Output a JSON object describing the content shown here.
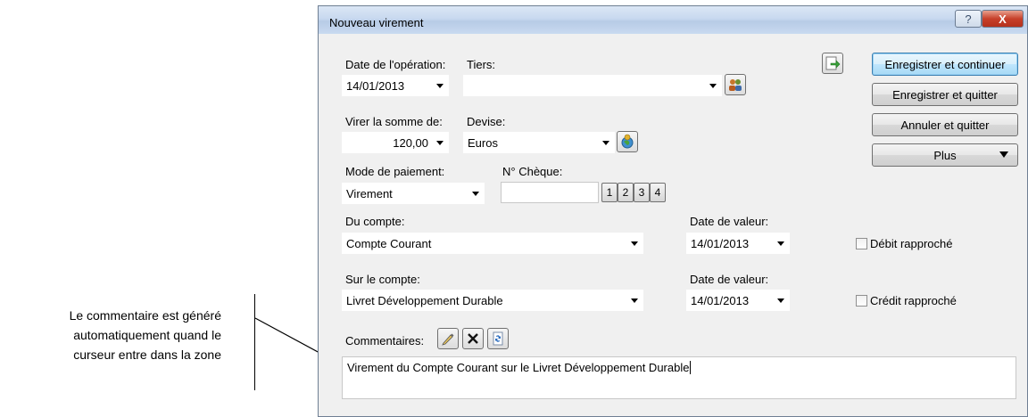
{
  "annotation": {
    "lines": [
      "Le commentaire est généré",
      "automatiquement quand le",
      "curseur entre dans la zone"
    ]
  },
  "window": {
    "title": "Nouveau virement",
    "help_label": "?",
    "close_label": "X"
  },
  "form": {
    "date_operation": {
      "label": "Date de l'opération:",
      "value": "14/01/2013"
    },
    "tiers": {
      "label": "Tiers:",
      "value": ""
    },
    "montant": {
      "label": "Virer la somme de:",
      "value": "120,00"
    },
    "devise": {
      "label": "Devise:",
      "value": "Euros"
    },
    "mode_paiement": {
      "label": "Mode de paiement:",
      "value": "Virement"
    },
    "cheque": {
      "label": "N° Chèque:",
      "value": "",
      "buttons": [
        "1",
        "2",
        "3",
        "4"
      ]
    },
    "du_compte": {
      "label": "Du compte:",
      "value": "Compte Courant"
    },
    "date_valeur_debit": {
      "label": "Date de valeur:",
      "value": "14/01/2013"
    },
    "debit_rapproche": {
      "label": "Débit rapproché",
      "checked": false
    },
    "sur_compte": {
      "label": "Sur le compte:",
      "value": "Livret Développement Durable"
    },
    "date_valeur_credit": {
      "label": "Date de valeur:",
      "value": "14/01/2013"
    },
    "credit_rapproche": {
      "label": "Crédit rapproché",
      "checked": false
    },
    "commentaires": {
      "label": "Commentaires:",
      "value": "Virement du Compte Courant sur le Livret Développement Durable"
    }
  },
  "buttons": {
    "save_continue": "Enregistrer et continuer",
    "save_quit": "Enregistrer et quitter",
    "cancel_quit": "Annuler et quitter",
    "more": "Plus"
  },
  "icons": {
    "export": "export-icon",
    "tiers": "people-icon",
    "currency": "currency-globe-icon",
    "edit": "pencil-icon",
    "clear": "clear-x-icon",
    "refresh": "refresh-icon"
  },
  "colors": {
    "default_button_border": "#3c7fb1",
    "close_button": "#c7402a",
    "titlebar": "#c8d9ef"
  }
}
